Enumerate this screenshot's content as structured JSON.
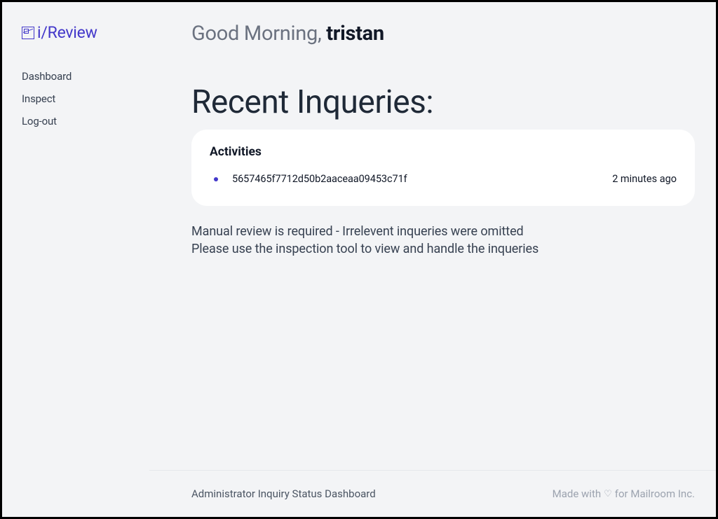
{
  "brand": {
    "name": "i/Review"
  },
  "sidebar": {
    "items": [
      {
        "label": "Dashboard"
      },
      {
        "label": "Inspect"
      },
      {
        "label": "Log-out"
      }
    ]
  },
  "greeting": {
    "prefix": "Good Morning, ",
    "name": "tristan"
  },
  "section": {
    "title": "Recent Inqueries:"
  },
  "card": {
    "title": "Activities",
    "items": [
      {
        "id": "5657465f7712d50b2aaceaa09453c71f",
        "time": "2 minutes ago"
      }
    ]
  },
  "notes": {
    "line1": "Manual review is required - Irrelevent inqueries were omitted",
    "line2": "Please use the inspection tool to view and handle the inqueries"
  },
  "footer": {
    "left": "Administrator Inquiry Status Dashboard",
    "right_prefix": "Made with ",
    "right_suffix": " for Mailroom Inc."
  }
}
